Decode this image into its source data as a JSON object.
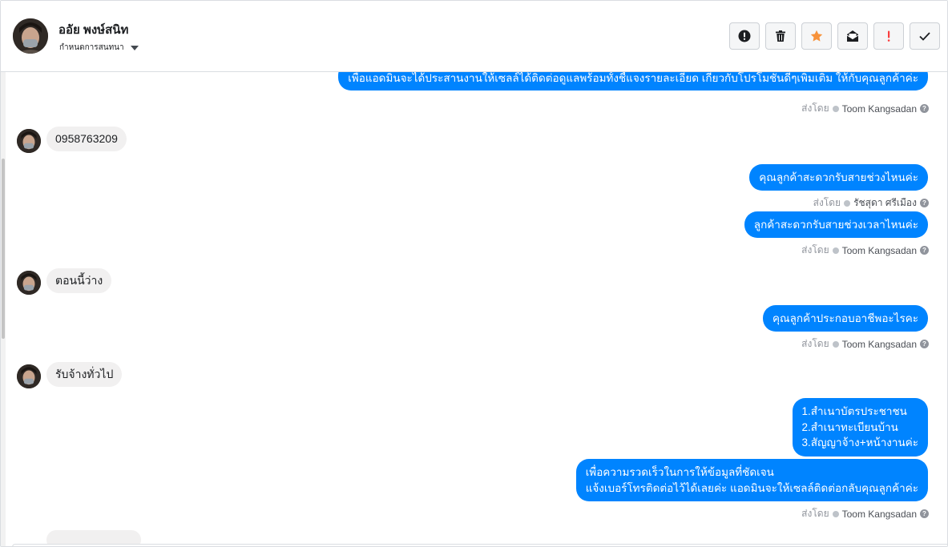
{
  "header": {
    "contact_name": "ออัย พงษ์สนิท",
    "conversation_menu_label": "กำหนดการสนทนา",
    "actions": [
      {
        "icon": "alert-circle-icon",
        "color": "#1c1e21"
      },
      {
        "icon": "trash-icon",
        "color": "#1c1e21"
      },
      {
        "icon": "star-icon",
        "color": "#f7923a"
      },
      {
        "icon": "mark-unread-icon",
        "color": "#1c1e21"
      },
      {
        "icon": "important-icon",
        "color": "#fa3e3e"
      },
      {
        "icon": "checkmark-icon",
        "color": "#1c1e21"
      }
    ]
  },
  "messages": {
    "top_partial": "เพื่อแอดมินจะได้ประสานงานให้เซลล์ได้ติดต่อดูแลพร้อมทั้งชี้แจงรายละเอียด เกี่ยวกับโปรโมชั่นดีๆเพิ่มเติม ให้กับคุณลูกค้าค่ะ",
    "sent_by_label": "ส่งโดย",
    "help_glyph": "?",
    "agents": {
      "toom": "Toom Kangsadan",
      "ratchasuda": "รัชสุดา ศรีเมือง"
    },
    "in_phone": "0958763209",
    "out_time_question": "คุณลูกค้าสะดวกรับสายช่วงไหนค่ะ",
    "out_time_question_2": "ลูกค้าสะดวกรับสายช่วงเวลาไหนค่ะ",
    "in_free_now": "ตอนนี้ว่าง",
    "out_occupation_q": "คุณลูกค้าประกอบอาชีพอะไรคะ",
    "in_occupation": "รับจ้างทั่วไป",
    "out_docs": [
      "1.สำเนาบัตรประชาชน",
      "2.สำเนาทะเบียนบ้าน",
      "3.สัญญาจ้าง+หน้างานค่ะ"
    ],
    "out_final": [
      "เพื่อความรวดเร็วในการให้ข้อมูลที่ชัดเจน",
      "แจ้งเบอร์โทรติดต่อไว้ได้เลยค่ะ แอดมินจะให้เซลล์ติดต่อกลับคุณลูกค้าค่ะ"
    ]
  },
  "colors": {
    "outgoing_bubble": "#0084ff",
    "incoming_bubble": "#f1f0f0"
  }
}
